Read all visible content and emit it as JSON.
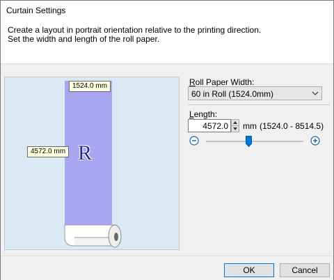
{
  "window": {
    "title": "Curtain Settings"
  },
  "description": {
    "line1": "Create a layout in portrait orientation relative to the printing direction.",
    "line2": "Set the width and length of the roll paper."
  },
  "preview": {
    "width_tag": "1524.0 mm",
    "length_tag": "4572.0 mm",
    "paper_letter": "R",
    "paper_color": "#a9a5f1",
    "background_color": "#d9eaf5"
  },
  "roll_width": {
    "label_mnemonic": "R",
    "label_rest": "oll Paper Width:",
    "selected": "60 in Roll (1524.0mm)"
  },
  "length": {
    "label_mnemonic": "L",
    "label_rest": "ength:",
    "value": "4572.0",
    "unit": "mm",
    "range": "(1524.0 - 8514.5)",
    "slider_fraction": 0.44
  },
  "buttons": {
    "ok": "OK",
    "cancel": "Cancel"
  },
  "icons": {
    "dropdown": "chevron-down-icon",
    "spin_up": "triangle-up-icon",
    "spin_down": "triangle-down-icon",
    "zoom_out": "minus-circle-icon",
    "zoom_in": "plus-circle-icon"
  },
  "colors": {
    "accent": "#0078d7"
  }
}
